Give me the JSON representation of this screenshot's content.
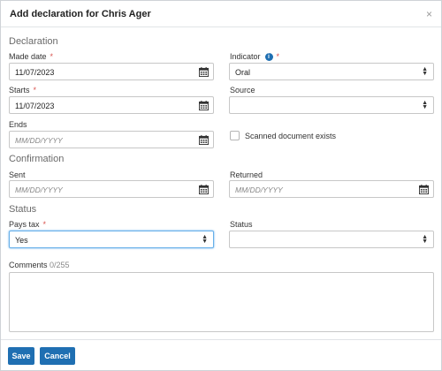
{
  "dialog": {
    "title": "Add declaration for Chris Ager",
    "close_glyph": "×"
  },
  "sections": {
    "declaration": "Declaration",
    "confirmation": "Confirmation",
    "status": "Status"
  },
  "fields": {
    "made_date": {
      "label": "Made date",
      "value": "11/07/2023",
      "required": "*"
    },
    "indicator": {
      "label": "Indicator",
      "value": "Oral",
      "required": "*",
      "info_glyph": "i"
    },
    "starts": {
      "label": "Starts",
      "value": "11/07/2023",
      "required": "*"
    },
    "source": {
      "label": "Source",
      "value": ""
    },
    "ends": {
      "label": "Ends",
      "placeholder": "MM/DD/YYYY"
    },
    "scanned": {
      "label": "Scanned document exists",
      "checked": false
    },
    "sent": {
      "label": "Sent",
      "placeholder": "MM/DD/YYYY"
    },
    "returned": {
      "label": "Returned",
      "placeholder": "MM/DD/YYYY"
    },
    "pays_tax": {
      "label": "Pays tax",
      "value": "Yes",
      "required": "*"
    },
    "status": {
      "label": "Status",
      "value": ""
    },
    "comments": {
      "label": "Comments",
      "count": "0/255",
      "value": ""
    }
  },
  "footer": {
    "save_label": "Save",
    "cancel_label": "Cancel"
  },
  "colors": {
    "primary_button": "#1f6fb2",
    "required": "#d9534f",
    "focus_ring": "#66afe9"
  },
  "icons": {
    "calendar": "calendar-icon",
    "select_caret": "select-caret-icon",
    "info": "info-icon",
    "close": "close-icon"
  }
}
